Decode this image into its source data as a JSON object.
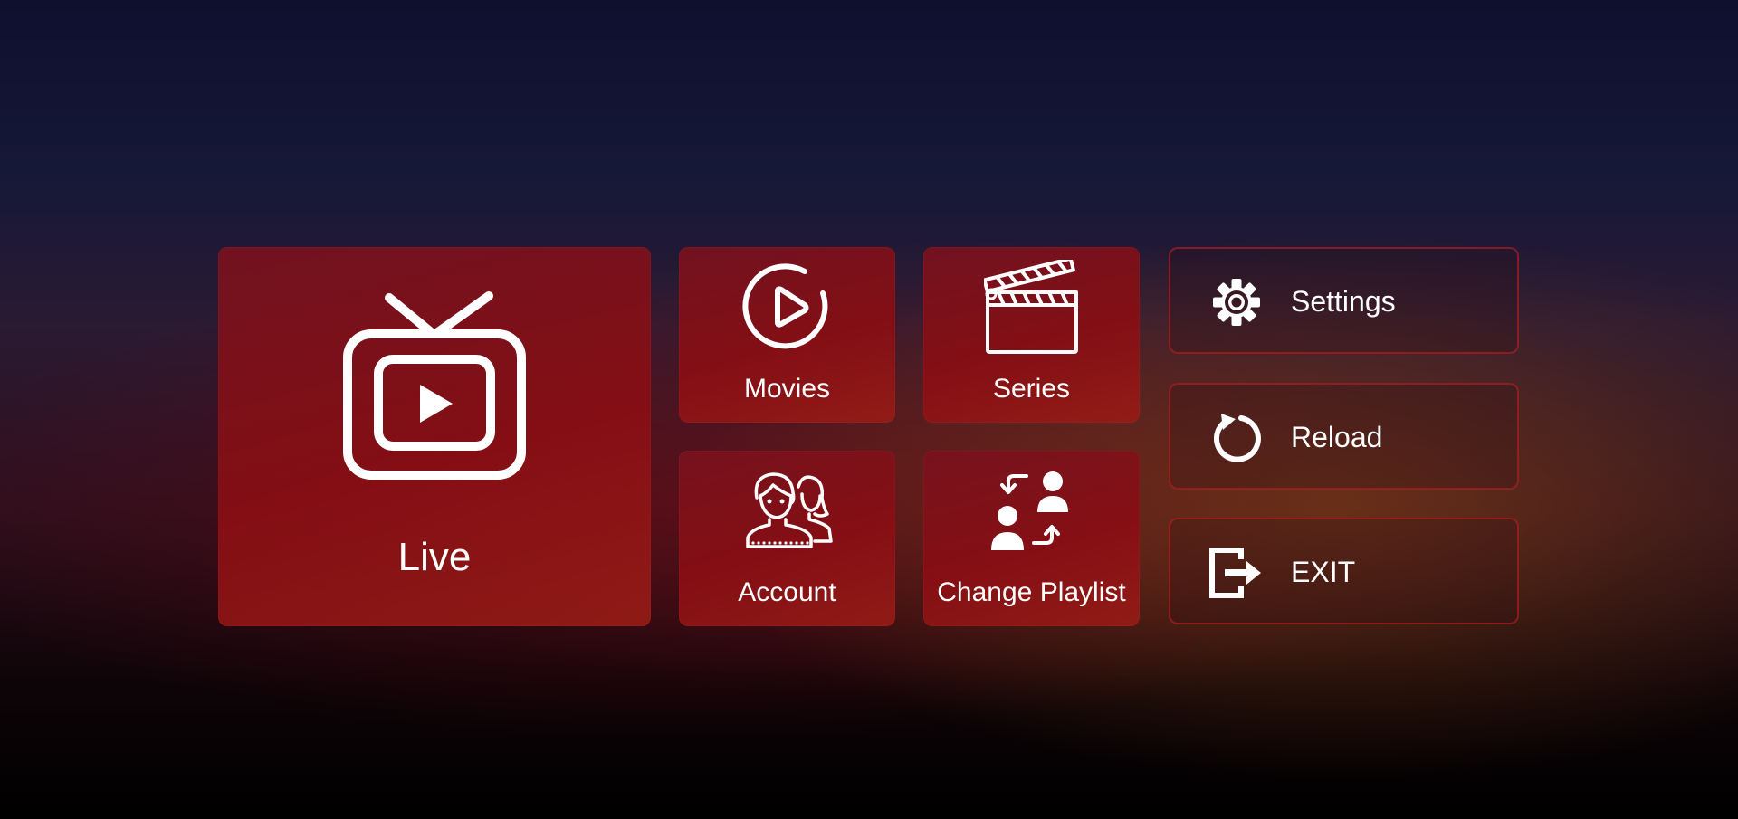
{
  "tiles": {
    "live": {
      "label": "Live",
      "icon": "tv-play-icon"
    },
    "movies": {
      "label": "Movies",
      "icon": "play-circle-icon"
    },
    "series": {
      "label": "Series",
      "icon": "clapperboard-icon"
    },
    "account": {
      "label": "Account",
      "icon": "users-icon"
    },
    "change_playlist": {
      "label": "Change Playlist",
      "icon": "swap-users-icon"
    }
  },
  "side_buttons": {
    "settings": {
      "label": "Settings",
      "icon": "gear-icon"
    },
    "reload": {
      "label": "Reload",
      "icon": "reload-icon"
    },
    "exit": {
      "label": "EXIT",
      "icon": "exit-icon"
    }
  },
  "colors": {
    "tile": "#7a0e18",
    "button_border": "#b91e23",
    "text": "#ffffff"
  }
}
